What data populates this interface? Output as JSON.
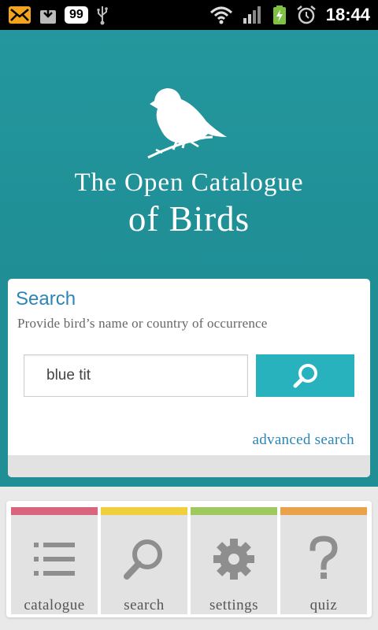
{
  "statusbar": {
    "icons": [
      "email-icon",
      "download-icon",
      "badge-icon",
      "usb-icon",
      "wifi-icon",
      "signal-icon",
      "battery-charging-icon",
      "alarm-icon"
    ],
    "badge": "99",
    "time": "18:44"
  },
  "header": {
    "title_line1": "The Open Catalogue",
    "title_line2": "of Birds"
  },
  "search": {
    "title": "Search",
    "subtitle": "Provide bird’s name or country of occurrence",
    "input_value": "blue tit",
    "button_icon": "search-icon",
    "advanced_link": "advanced search"
  },
  "nav": {
    "items": [
      {
        "label": "catalogue",
        "icon": "list-icon",
        "color": "#d8647e"
      },
      {
        "label": "search",
        "icon": "search-icon",
        "color": "#f0cf3c"
      },
      {
        "label": "settings",
        "icon": "gear-icon",
        "color": "#9dc95f"
      },
      {
        "label": "quiz",
        "icon": "question-icon",
        "color": "#e9a24a"
      }
    ]
  },
  "colors": {
    "teal": "#1f8e95",
    "button": "#27b2bd",
    "link": "#2b85b6"
  }
}
